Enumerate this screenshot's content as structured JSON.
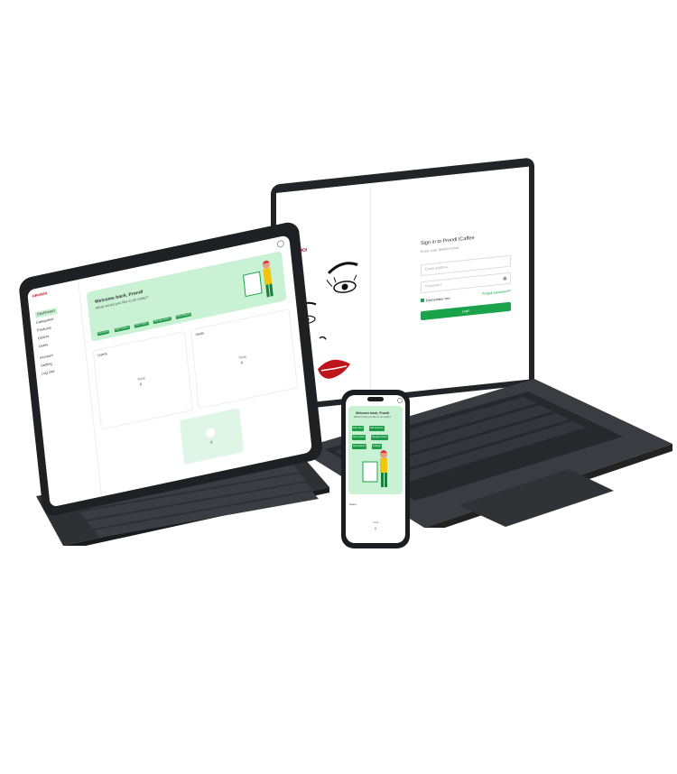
{
  "laptop": {
    "logo": "HRUMOI",
    "signin_title": "Sign in to Prondl ICaffee",
    "signin_subtitle": "Enter your details below",
    "email_placeholder": "Email address",
    "password_placeholder": "Password",
    "forgot_label": "Forgot password?",
    "remember_label": "Remember me",
    "login_label": "Login"
  },
  "tablet": {
    "logo": "HRUMOI",
    "welcome": "Welcome back, Prondl",
    "welcome_sub": "What would you like to do today?",
    "sidebar": [
      "Dashboard",
      "Categories",
      "Products",
      "Orders",
      "Users",
      "Account",
      "Setting",
      "Log Out"
    ],
    "chips": [
      "Add Users",
      "Add Products",
      "View Orders",
      "Manage Orders",
      "View Reports"
    ],
    "card_left_title": "Users",
    "card_left_label": "Total",
    "card_left_value": "0",
    "card_right_title": "Visits",
    "card_right_label": "Total",
    "card_right_value": "0",
    "bottom_value": "0"
  },
  "phone": {
    "welcome": "Welcome back, Prondl",
    "welcome_sub": "What would you like to do today?",
    "chips": [
      "Add Users",
      "Add Products",
      "View Orders",
      "Manage Orders",
      "View Reports",
      "Settings"
    ],
    "section_title": "Users",
    "section_label": "Total",
    "section_value": "0"
  },
  "colors": {
    "accent": "#1aa34a",
    "banner": "#c9f2d4",
    "device": "#1f2024",
    "lips": "#c0141c"
  }
}
